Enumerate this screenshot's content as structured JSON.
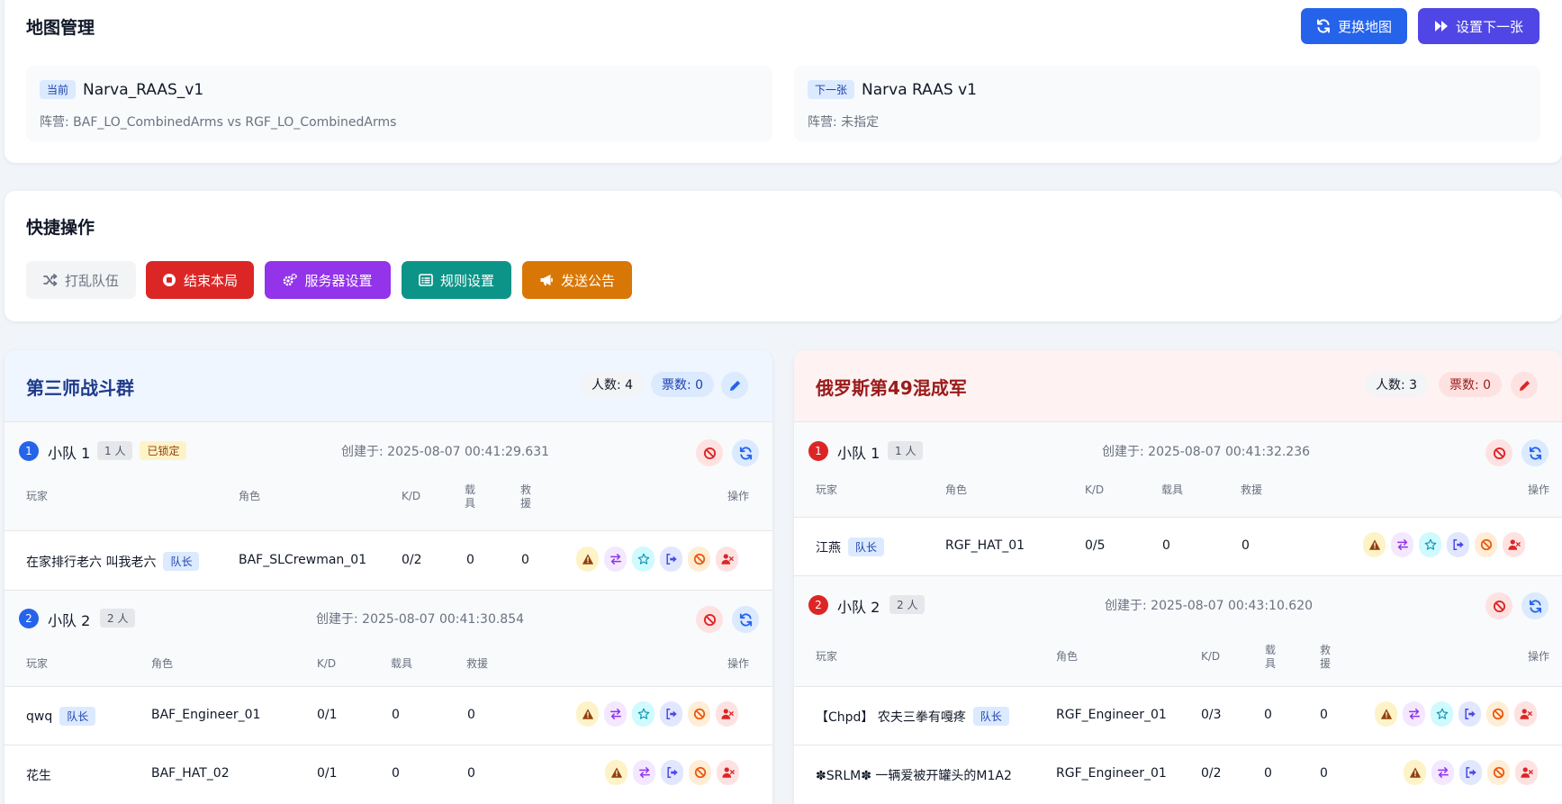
{
  "map_card": {
    "title": "地图管理",
    "change_map_label": "更换地图",
    "set_next_label": "设置下一张",
    "current": {
      "tag": "当前",
      "name": "Narva_RAAS_v1",
      "faction": "阵营: BAF_LO_CombinedArms vs RGF_LO_CombinedArms"
    },
    "next": {
      "tag": "下一张",
      "name": "Narva RAAS v1",
      "faction": "阵营: 未指定"
    }
  },
  "quick": {
    "title": "快捷操作",
    "shuffle": "打乱队伍",
    "end_round": "结束本局",
    "server_settings": "服务器设置",
    "rules": "规则设置",
    "broadcast": "发送公告"
  },
  "teams": {
    "t1": {
      "name": "第三师战斗群",
      "count": "人数: 4",
      "votes": "票数: 0",
      "headers": [
        "玩家",
        "角色",
        "K/D",
        "载具",
        "救援",
        "操作"
      ],
      "squads": [
        {
          "num": "1",
          "name": "小队 1",
          "size": "1 人",
          "locked": "已锁定",
          "created": "创建于: 2025-08-07 00:41:29.631",
          "players": [
            {
              "name": "在家排行老六 叫我老六",
              "leader": "队长",
              "role": "BAF_SLCrewman_01",
              "kd": "0/2",
              "veh": "0",
              "rev": "0"
            }
          ]
        },
        {
          "num": "2",
          "name": "小队 2",
          "size": "2 人",
          "created": "创建于: 2025-08-07 00:41:30.854",
          "players": [
            {
              "name": "qwq",
              "leader": "队长",
              "role": "BAF_Engineer_01",
              "kd": "0/1",
              "veh": "0",
              "rev": "0"
            },
            {
              "name": "花生",
              "role": "BAF_HAT_02",
              "kd": "0/1",
              "veh": "0",
              "rev": "0"
            }
          ]
        }
      ]
    },
    "t2": {
      "name": "俄罗斯第49混成军",
      "count": "人数: 3",
      "votes": "票数: 0",
      "headers": [
        "玩家",
        "角色",
        "K/D",
        "载具",
        "救援",
        "操作"
      ],
      "squads": [
        {
          "num": "1",
          "name": "小队 1",
          "size": "1 人",
          "created": "创建于: 2025-08-07 00:41:32.236",
          "players": [
            {
              "name": "江燕",
              "leader": "队长",
              "role": "RGF_HAT_01",
              "kd": "0/5",
              "veh": "0",
              "rev": "0"
            }
          ]
        },
        {
          "num": "2",
          "name": "小队 2",
          "size": "2 人",
          "created": "创建于: 2025-08-07 00:43:10.620",
          "players": [
            {
              "name": "【Chpd】 农夫三拳有嘎疼",
              "leader": "队长",
              "role": "RGF_Engineer_01",
              "kd": "0/3",
              "veh": "0",
              "rev": "0"
            },
            {
              "name": "✽SRLM✽ 一辆爱被开罐头的M1A2",
              "role": "RGF_Engineer_01",
              "kd": "0/2",
              "veh": "0",
              "rev": "0"
            }
          ]
        }
      ]
    }
  },
  "colors": {
    "blue": "#2563eb",
    "indigo": "#4f46e5",
    "red": "#dc2626",
    "purple": "#9333ea",
    "teal": "#0d9488",
    "orange": "#d97706",
    "team1": "#1e3a8a",
    "team2": "#991b1b"
  },
  "icons": {
    "change_map": "sync-icon",
    "set_next": "fast-forward-icon",
    "shuffle": "random-icon",
    "end_round": "stop-circle-icon",
    "server_settings": "cogs-icon",
    "rules": "list-alt-icon",
    "broadcast": "bullhorn-icon",
    "edit": "pencil-icon",
    "disband": "ban-icon",
    "refresh": "sync-icon",
    "warn": "warning-icon",
    "swap": "exchange-icon",
    "promote": "star-icon",
    "move": "sign-out-icon",
    "ban": "ban-icon",
    "kick": "user-times-icon"
  }
}
